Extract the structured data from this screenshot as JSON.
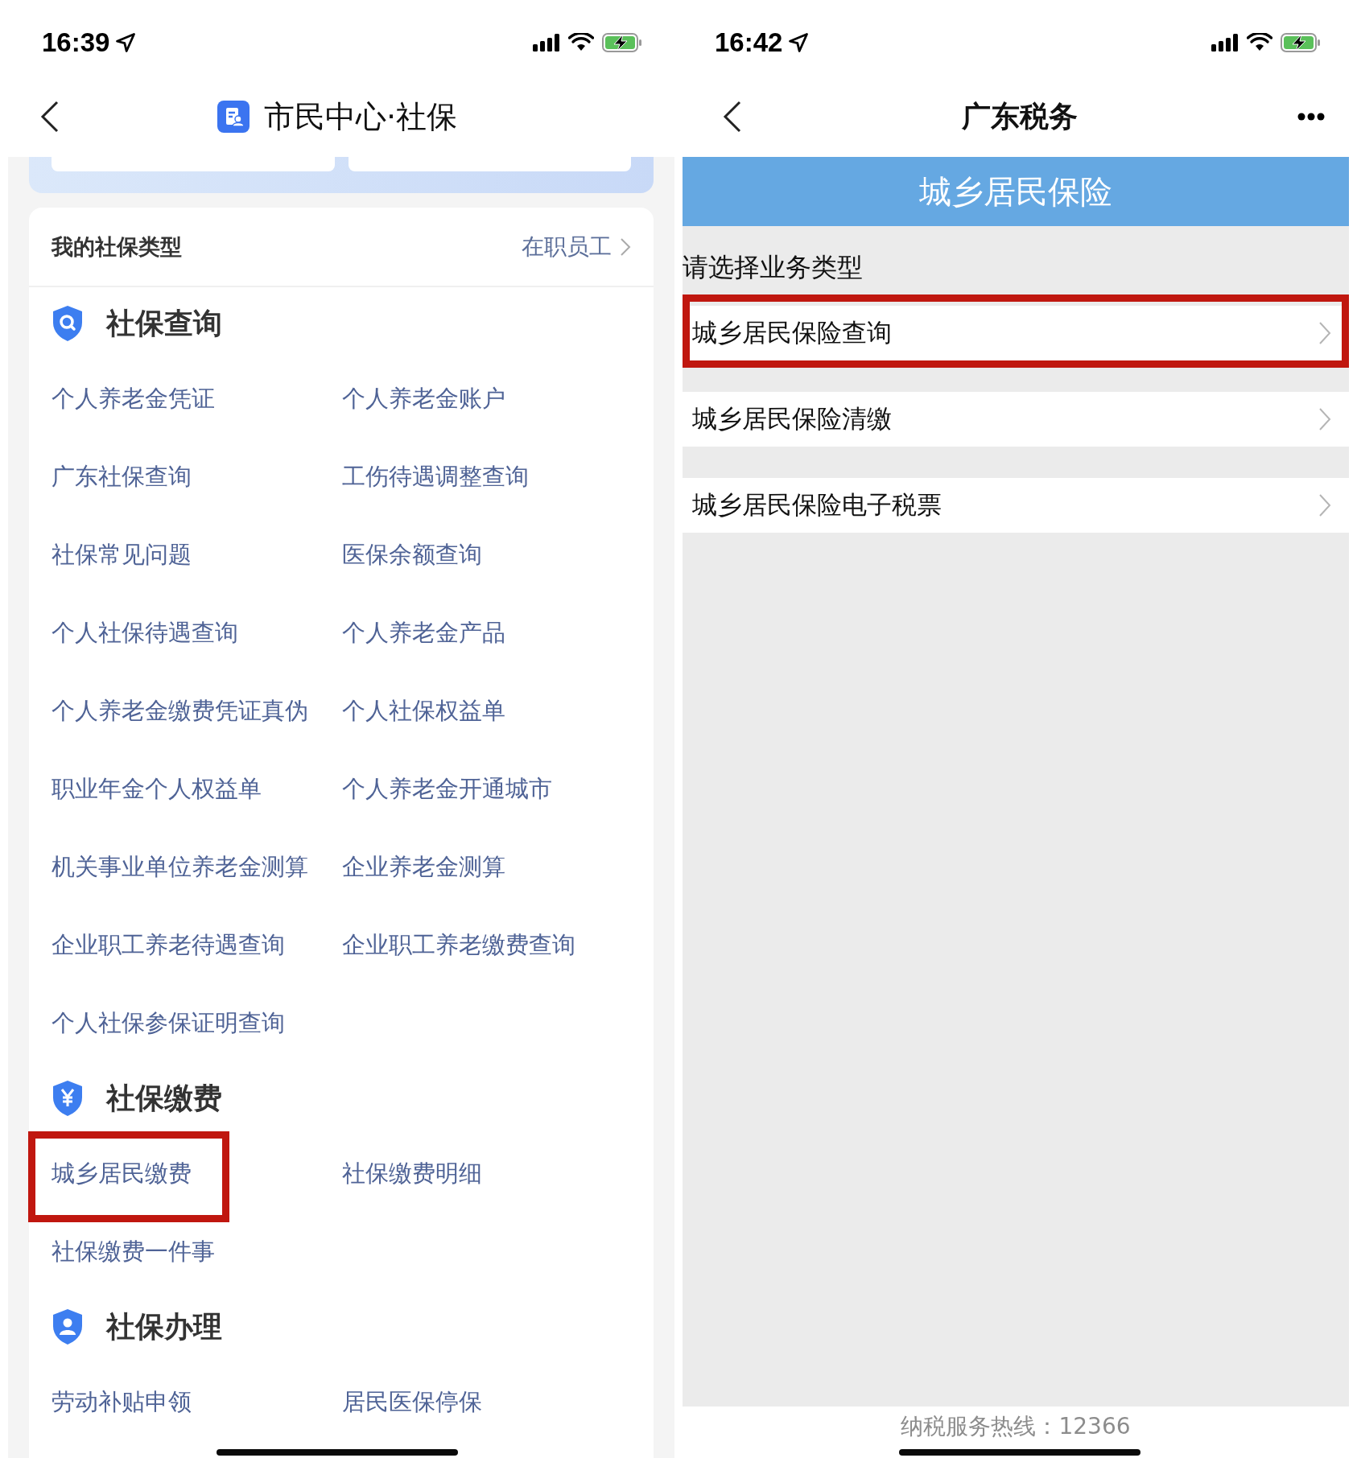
{
  "left_screen": {
    "status_bar": {
      "time": "16:39"
    },
    "nav": {
      "title": "市民中心·社保"
    },
    "social_security_type": {
      "label": "我的社保类型",
      "value": "在职员工"
    },
    "sections": [
      {
        "title": "社保查询",
        "kind": "search",
        "items": [
          {
            "label": "个人养老金凭证",
            "highlighted": false
          },
          {
            "label": "个人养老金账户",
            "highlighted": false
          },
          {
            "label": "广东社保查询",
            "highlighted": false
          },
          {
            "label": "工伤待遇调整查询",
            "highlighted": false
          },
          {
            "label": "社保常见问题",
            "highlighted": false
          },
          {
            "label": "医保余额查询",
            "highlighted": false
          },
          {
            "label": "个人社保待遇查询",
            "highlighted": false
          },
          {
            "label": "个人养老金产品",
            "highlighted": false
          },
          {
            "label": "个人养老金缴费凭证真伪",
            "highlighted": false
          },
          {
            "label": "个人社保权益单",
            "highlighted": false
          },
          {
            "label": "职业年金个人权益单",
            "highlighted": false
          },
          {
            "label": "个人养老金开通城市",
            "highlighted": false
          },
          {
            "label": "机关事业单位养老金测算",
            "highlighted": false
          },
          {
            "label": "企业养老金测算",
            "highlighted": false
          },
          {
            "label": "企业职工养老待遇查询",
            "highlighted": false
          },
          {
            "label": "企业职工养老缴费查询",
            "highlighted": false
          },
          {
            "label": "个人社保参保证明查询",
            "highlighted": false
          }
        ]
      },
      {
        "title": "社保缴费",
        "kind": "payment",
        "items": [
          {
            "label": "城乡居民缴费",
            "highlighted": true
          },
          {
            "label": "社保缴费明细",
            "highlighted": false
          },
          {
            "label": "社保缴费一件事",
            "highlighted": false
          }
        ]
      },
      {
        "title": "社保办理",
        "kind": "person",
        "items": [
          {
            "label": "劳动补贴申领",
            "highlighted": false
          },
          {
            "label": "居民医保停保",
            "highlighted": false
          }
        ]
      }
    ]
  },
  "right_screen": {
    "status_bar": {
      "time": "16:42"
    },
    "nav": {
      "title": "广东税务"
    },
    "banner": "城乡居民保险",
    "prompt": "请选择业务类型",
    "options": [
      {
        "label": "城乡居民保险查询",
        "highlighted": true
      },
      {
        "label": "城乡居民保险清缴",
        "highlighted": false
      },
      {
        "label": "城乡居民保险电子税票",
        "highlighted": false
      }
    ],
    "footer": "纳税服务热线：12366"
  }
}
